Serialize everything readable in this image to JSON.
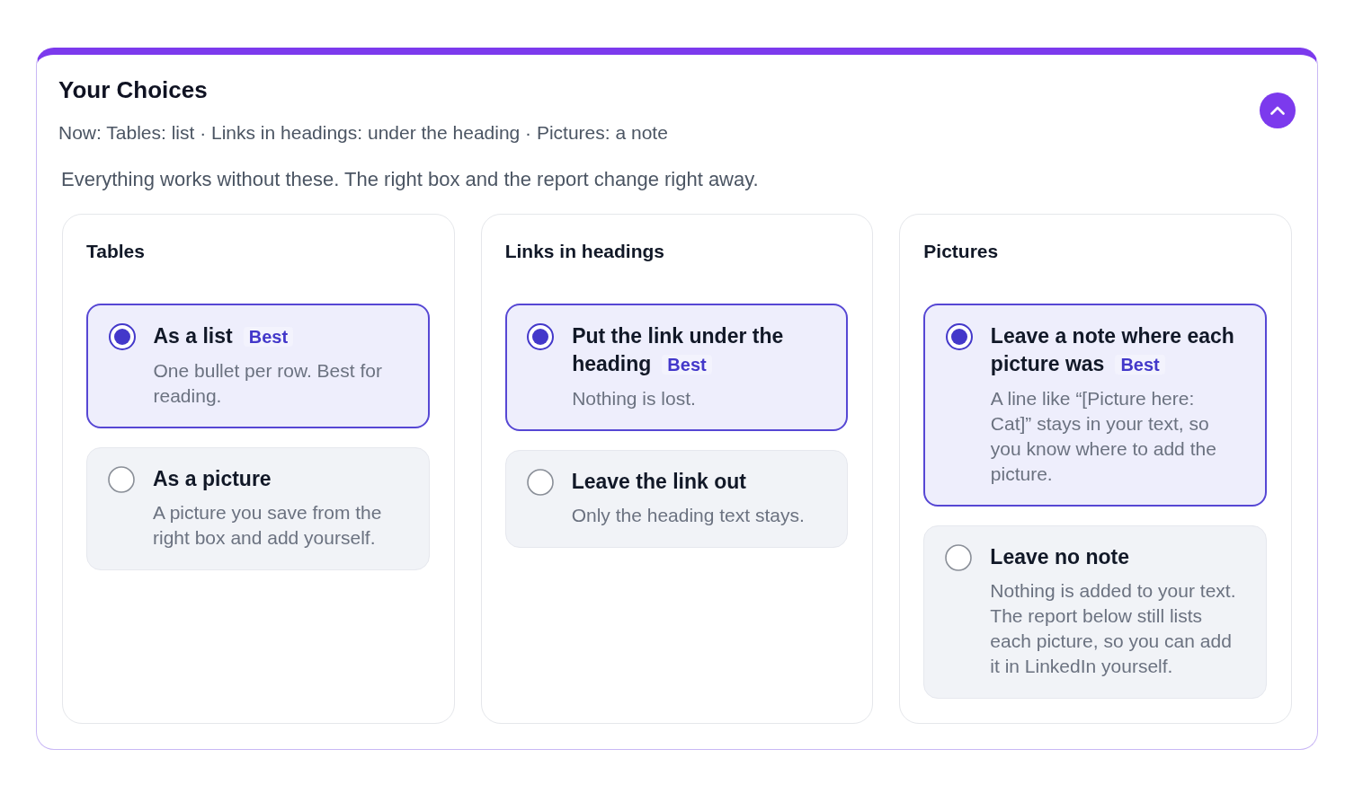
{
  "panel": {
    "title": "Your Choices",
    "summary": "Now: Tables: list · Links in headings: under the heading · Pictures: a note",
    "expanded": true,
    "intro": "Everything works without these. The right box and the report change right away.",
    "groups": [
      {
        "heading": "Tables",
        "options": [
          {
            "label": "As a list",
            "badge": "Best",
            "description": "One bullet per row. Best for reading.",
            "selected": true
          },
          {
            "label": "As a picture",
            "description": "A picture you save from the right box and add yourself.",
            "selected": false
          }
        ]
      },
      {
        "heading": "Links in headings",
        "options": [
          {
            "label": "Put the link under the heading",
            "badge": "Best",
            "description": "Nothing is lost.",
            "selected": true
          },
          {
            "label": "Leave the link out",
            "description": "Only the heading text stays.",
            "selected": false
          }
        ]
      },
      {
        "heading": "Pictures",
        "options": [
          {
            "label": "Leave a note where each picture was",
            "badge": "Best",
            "description": "A line like “[Picture here: Cat]” stays in your text, so you know where to add the picture.",
            "selected": true
          },
          {
            "label": "Leave no note",
            "description": "Nothing is added to your text. The report below still lists each picture, so you can add it in LinkedIn yourself.",
            "selected": false
          }
        ]
      }
    ]
  }
}
